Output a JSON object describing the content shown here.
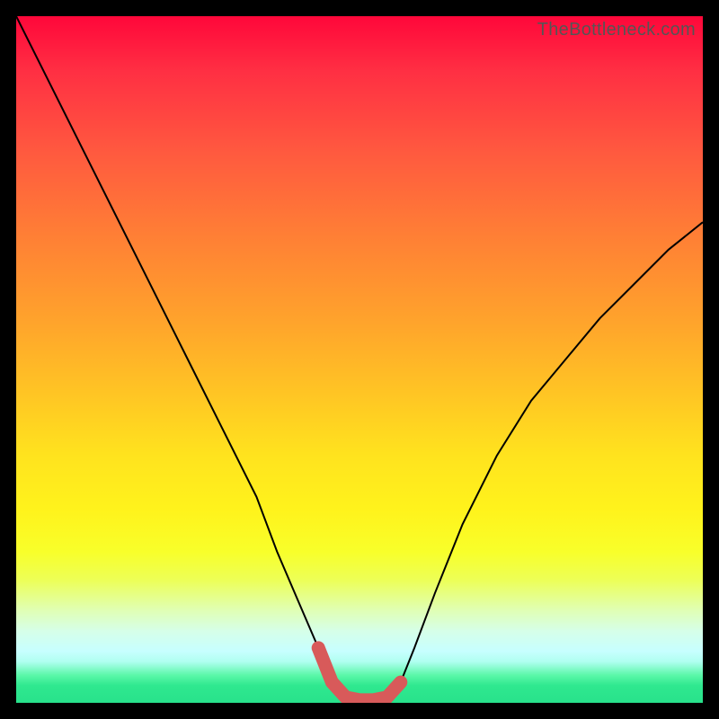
{
  "watermark": "TheBottleneck.com",
  "chart_data": {
    "type": "line",
    "title": "",
    "xlabel": "",
    "ylabel": "",
    "xlim": [
      0,
      100
    ],
    "ylim": [
      0,
      100
    ],
    "series": [
      {
        "name": "bottleneck-curve",
        "x": [
          0,
          5,
          10,
          15,
          20,
          25,
          30,
          35,
          38,
          41,
          44,
          46,
          48,
          50,
          52,
          54,
          56,
          58,
          61,
          65,
          70,
          75,
          80,
          85,
          90,
          95,
          100
        ],
        "values": [
          100,
          90,
          80,
          70,
          60,
          50,
          40,
          30,
          22,
          15,
          8,
          3,
          0.8,
          0.4,
          0.4,
          0.8,
          3,
          8,
          16,
          26,
          36,
          44,
          50,
          56,
          61,
          66,
          70
        ]
      }
    ],
    "accent_segment": {
      "name": "optimal-range-marker",
      "x": [
        44,
        46,
        48,
        50,
        52,
        54,
        56
      ],
      "values": [
        8,
        3,
        0.8,
        0.4,
        0.4,
        0.8,
        3
      ]
    },
    "background_gradient": {
      "top": "#ff073a",
      "mid_upper": "#ff7f35",
      "mid": "#ffe31e",
      "lower": "#edff55",
      "bottom": "#28e28b"
    }
  }
}
